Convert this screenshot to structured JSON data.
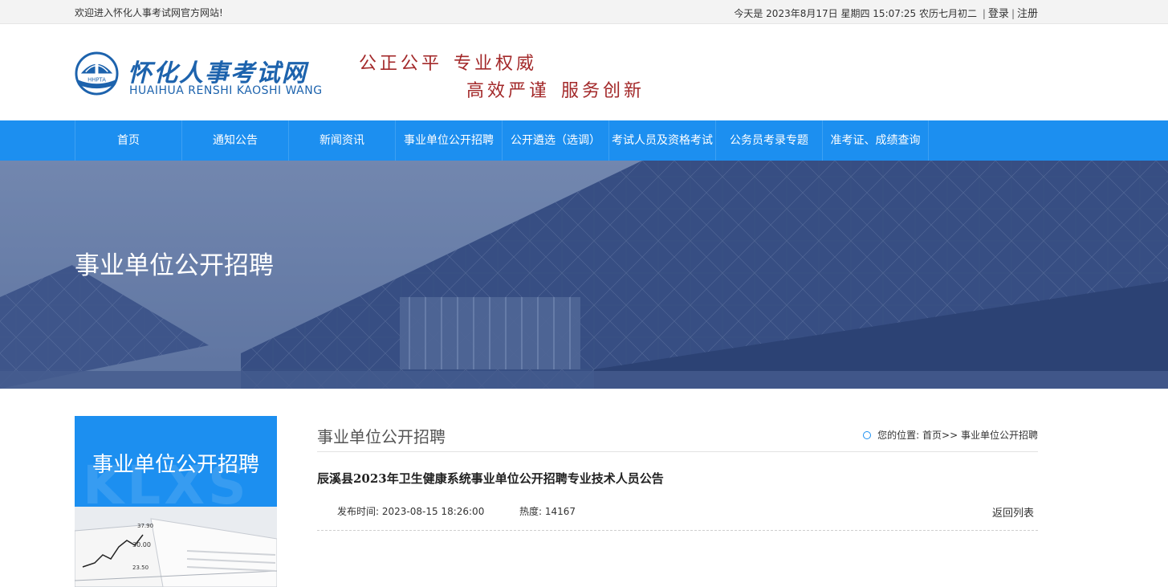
{
  "topbar": {
    "welcome": "欢迎进入怀化人事考试网官方网站!",
    "date_prefix": "今天是",
    "date": "2023年8月17日",
    "weekday": "星期四",
    "time": "15:07:25",
    "lunar": "农历七月初二",
    "login": "登录",
    "register": "注册",
    "separator": "|"
  },
  "header": {
    "logo_cn": "怀化人事考试网",
    "logo_en": "HUAIHUA RENSHI KAOSHI WANG",
    "logo_badge": "HHPTA",
    "slogan_1a": "公正公平",
    "slogan_1b": "专业权威",
    "slogan_2a": "高效严谨",
    "slogan_2b": "服务创新"
  },
  "nav": {
    "items": [
      "首页",
      "通知公告",
      "新闻资讯",
      "事业单位公开招聘",
      "公开遴选（选调）",
      "考试人员及资格考试",
      "公务员考录专题",
      "准考证、成绩查询"
    ]
  },
  "banner": {
    "title": "事业单位公开招聘"
  },
  "sidebar": {
    "title": "事业单位公开招聘",
    "watermark": "KLXS",
    "img_numbers": [
      "37.90",
      "30.00",
      "23.50"
    ]
  },
  "main": {
    "category": "事业单位公开招聘",
    "crumb_prefix": "您的位置:",
    "crumb_home": "首页",
    "crumb_arrow": ">>",
    "crumb_current": "事业单位公开招聘",
    "article_title": "辰溪县2023年卫生健康系统事业单位公开招聘专业技术人员公告",
    "publish_label": "发布时间:",
    "publish_time": "2023-08-15 18:26:00",
    "hot_label": "热度:",
    "hot_value": "14167",
    "back_label": "返回列表"
  },
  "colors": {
    "primary_blue": "#1c8ff0",
    "slogan_red": "#a3292a",
    "logo_blue": "#1d63ad"
  }
}
